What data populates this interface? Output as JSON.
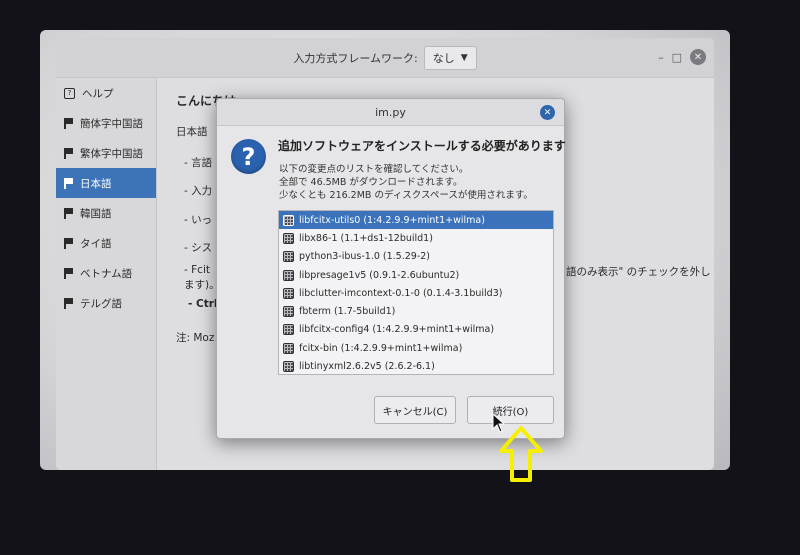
{
  "titlebar": {
    "framework_label": "入力方式フレームワーク:",
    "framework_value": "なし",
    "minimize": "–",
    "maximize": "□",
    "close": "✕"
  },
  "sidebar": {
    "items": [
      {
        "label": "ヘルプ",
        "icon": "help-icon"
      },
      {
        "label": "簡体字中国語",
        "icon": "flag-icon"
      },
      {
        "label": "繁体字中国語",
        "icon": "flag-icon"
      },
      {
        "label": "日本語",
        "icon": "flag-icon",
        "active": true
      },
      {
        "label": "韓国語",
        "icon": "flag-icon"
      },
      {
        "label": "タイ語",
        "icon": "flag-icon"
      },
      {
        "label": "ベトナム語",
        "icon": "flag-icon"
      },
      {
        "label": "テルグ語",
        "icon": "flag-icon"
      }
    ]
  },
  "content": {
    "heading": "こんにちは",
    "line1": "日本語",
    "bullet1": "- 言語",
    "bullet2": "- 入力",
    "bullet3": "- いっ",
    "bullet4": "- シス",
    "bullet5": "- Fcit",
    "bullet5_right": "語のみ表示\" のチェックを外し",
    "line_ja": "ます)。",
    "ctrl": "- Ctrl",
    "note": "注: Moz"
  },
  "dialog": {
    "title": "im.py",
    "heading": "追加ソフトウェアをインストールする必要があります",
    "desc_line1": "以下の変更点のリストを確認してください。",
    "desc_line2": "全部で 46.5MB がダウンロードされます。",
    "desc_line3": "少なくとも 216.2MB のディスクスペースが使用されます。",
    "packages": [
      "libfcitx-utils0 (1:4.2.9.9+mint1+wilma)",
      "libx86-1 (1.1+ds1-12build1)",
      "python3-ibus-1.0 (1.5.29-2)",
      "libpresage1v5 (0.9.1-2.6ubuntu2)",
      "libclutter-imcontext-0.1-0 (0.1.4-3.1build3)",
      "fbterm (1.7-5build1)",
      "libfcitx-config4 (1:4.2.9.9+mint1+wilma)",
      "fcitx-bin (1:4.2.9.9+mint1+wilma)",
      "libtinyxml2.6.2v5 (2.6.2-6.1)"
    ],
    "cancel_label": "キャンセル(C)",
    "continue_label": "続行(O)"
  },
  "colors": {
    "accent": "#3d74b8",
    "annotation": "#f5f000"
  }
}
